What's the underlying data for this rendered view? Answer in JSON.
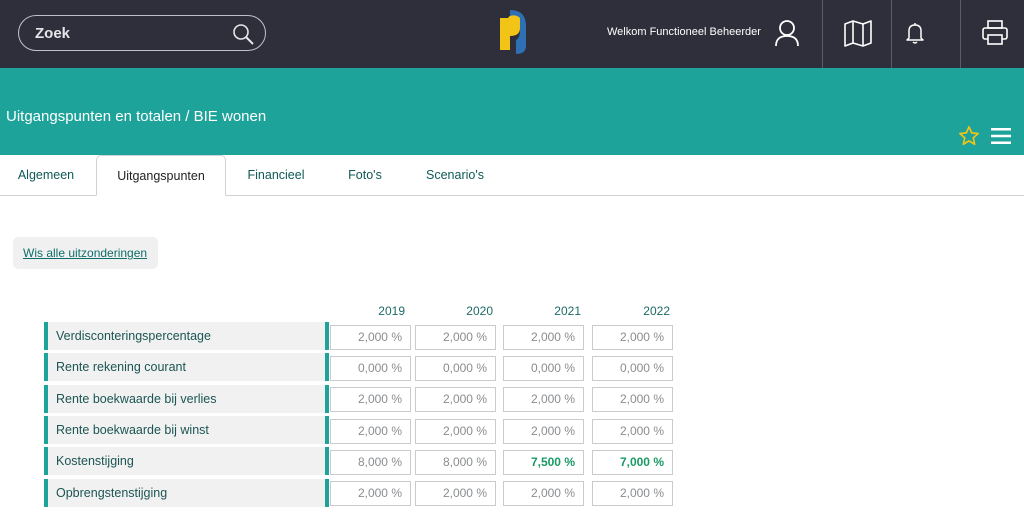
{
  "topbar": {
    "search_placeholder": "Zoek",
    "welcome": "Welkom Functioneel Beheerder",
    "icons": [
      "search-icon",
      "logo",
      "user-icon",
      "map-icon",
      "bell-icon",
      "printer-icon"
    ]
  },
  "header": {
    "title": "Uitgangspunten en totalen / BIE wonen",
    "icons": [
      "star-icon",
      "menu-icon"
    ],
    "colors": {
      "teal": "#1ea39b",
      "dark": "#2e2f3a",
      "star": "#f2c418"
    }
  },
  "tabs": [
    {
      "label": "Algemeen",
      "active": false
    },
    {
      "label": "Uitgangspunten",
      "active": true
    },
    {
      "label": "Financieel",
      "active": false
    },
    {
      "label": "Foto's",
      "active": false
    },
    {
      "label": "Scenario's",
      "active": false
    }
  ],
  "clear_button": "Wis alle uitzonderingen",
  "table": {
    "years": [
      "2019",
      "2020",
      "2021",
      "2022"
    ],
    "rows": [
      {
        "label": "Verdisconteringspercentage",
        "values": [
          "2,000 %",
          "2,000 %",
          "2,000 %",
          "2,000 %"
        ],
        "highlight": [
          false,
          false,
          false,
          false
        ]
      },
      {
        "label": "Rente rekening courant",
        "values": [
          "0,000 %",
          "0,000 %",
          "0,000 %",
          "0,000 %"
        ],
        "highlight": [
          false,
          false,
          false,
          false
        ]
      },
      {
        "label": "Rente boekwaarde bij verlies",
        "values": [
          "2,000 %",
          "2,000 %",
          "2,000 %",
          "2,000 %"
        ],
        "highlight": [
          false,
          false,
          false,
          false
        ]
      },
      {
        "label": "Rente boekwaarde bij winst",
        "values": [
          "2,000 %",
          "2,000 %",
          "2,000 %",
          "2,000 %"
        ],
        "highlight": [
          false,
          false,
          false,
          false
        ]
      },
      {
        "label": "Kostenstijging",
        "values": [
          "8,000 %",
          "8,000 %",
          "7,500 %",
          "7,000 %"
        ],
        "highlight": [
          false,
          false,
          true,
          true
        ]
      },
      {
        "label": "Opbrengstenstijging",
        "values": [
          "2,000 %",
          "2,000 %",
          "2,000 %",
          "2,000 %"
        ],
        "highlight": [
          false,
          false,
          false,
          false
        ]
      }
    ]
  }
}
